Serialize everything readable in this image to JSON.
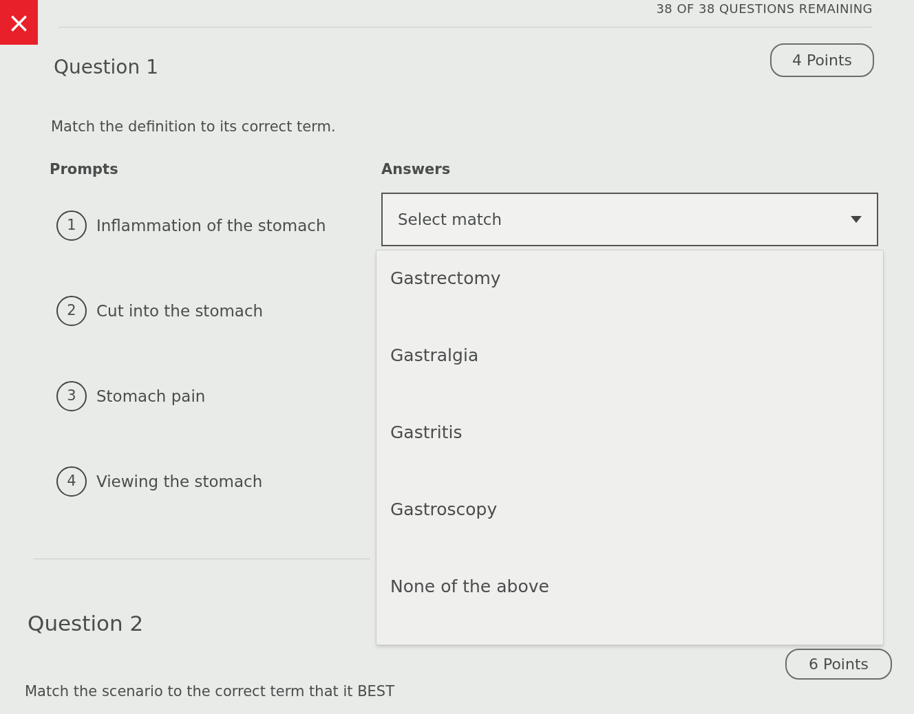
{
  "header": {
    "close_icon": "×",
    "remaining": "38 OF 38 QUESTIONS REMAINING"
  },
  "question_1": {
    "title": "Question 1",
    "points": "4 Points",
    "instruction": "Match the definition to its correct term.",
    "prompts_heading": "Prompts",
    "answers_heading": "Answers",
    "prompts": [
      {
        "number": "1",
        "text": "Inflammation of the stomach"
      },
      {
        "number": "2",
        "text": "Cut into the stomach"
      },
      {
        "number": "3",
        "text": "Stomach pain"
      },
      {
        "number": "4",
        "text": "Viewing the stomach"
      }
    ],
    "select": {
      "placeholder": "Select match",
      "expanded": true,
      "options": [
        "Gastrectomy",
        "Gastralgia",
        "Gastritis",
        "Gastroscopy",
        "None of the above"
      ]
    }
  },
  "question_2": {
    "title": "Question 2",
    "points": "6 Points",
    "instruction": "Match the scenario to the correct term that it BEST"
  }
}
